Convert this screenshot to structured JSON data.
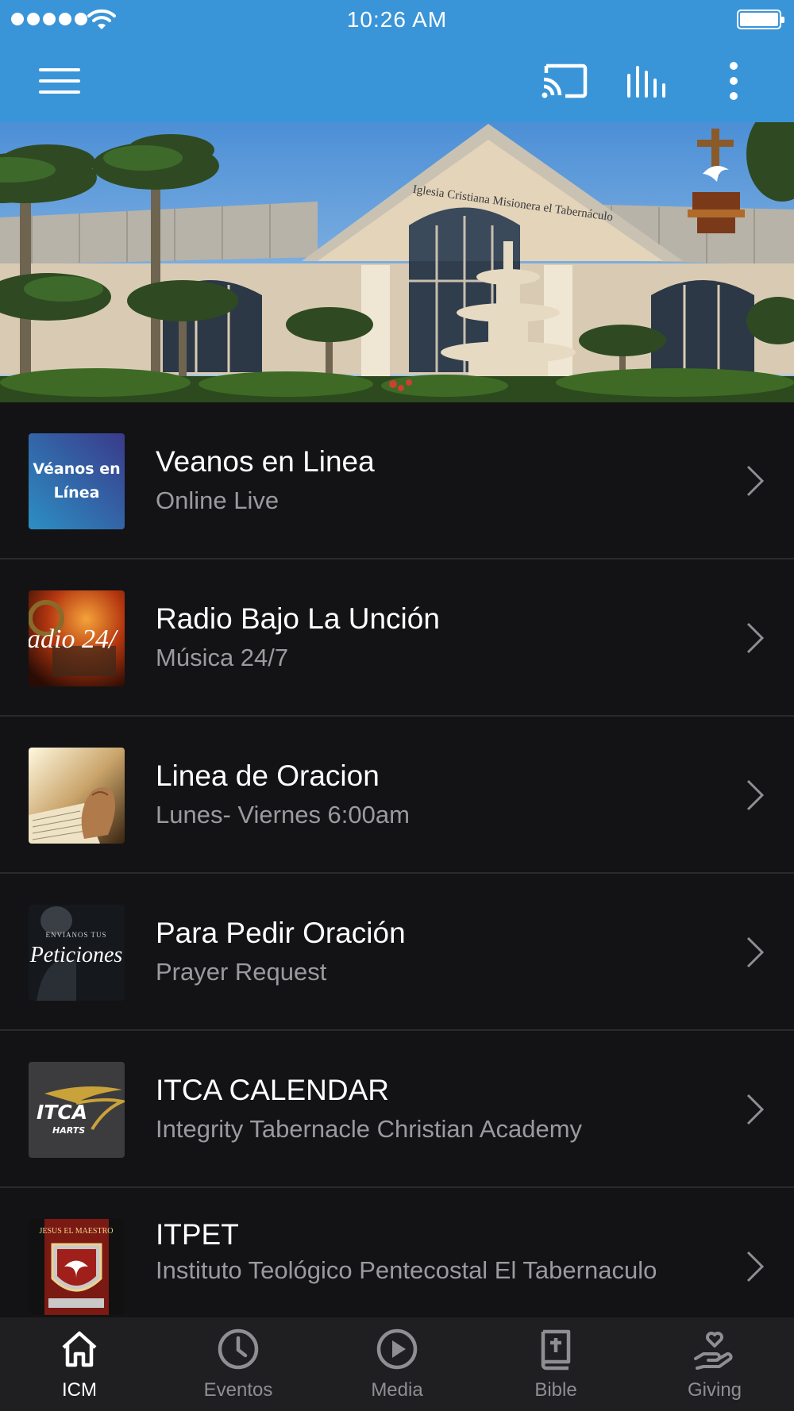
{
  "status_bar": {
    "time": "10:26 AM"
  },
  "toolbar": {
    "menu_icon": "hamburger-menu-icon",
    "cast_icon": "cast-icon",
    "audio_icon": "audio-equalizer-icon",
    "more_icon": "more-vertical-icon"
  },
  "hero": {
    "sign_text": "Iglesia Cristiana Misionera el Tabernáculo"
  },
  "list": {
    "items": [
      {
        "title": "Veanos en Linea",
        "subtitle": "Online Live",
        "thumb_text": "Véanos en Línea"
      },
      {
        "title": "Radio Bajo La Unción",
        "subtitle": "Música 24/7",
        "thumb_text": "adio 24/"
      },
      {
        "title": "Linea de Oracion",
        "subtitle": "Lunes- Viernes 6:00am"
      },
      {
        "title": "Para Pedir Oración",
        "subtitle": "Prayer Request",
        "thumb_text_small": "ENVIANOS TUS",
        "thumb_text": "Peticiones"
      },
      {
        "title": "ITCA CALENDAR",
        "subtitle": "Integrity Tabernacle Christian Academy",
        "thumb_text": "ITCA",
        "thumb_text_small": "HARTS"
      },
      {
        "title": "ITPET",
        "subtitle": "Instituto Teológico Pentecostal El Tabernaculo",
        "thumb_text_small": "JESUS EL MAESTRO"
      }
    ]
  },
  "tabbar": {
    "tabs": [
      {
        "label": "ICM",
        "icon": "home-icon",
        "active": true
      },
      {
        "label": "Eventos",
        "icon": "clock-icon",
        "active": false
      },
      {
        "label": "Media",
        "icon": "play-circle-icon",
        "active": false
      },
      {
        "label": "Bible",
        "icon": "bible-icon",
        "active": false
      },
      {
        "label": "Giving",
        "icon": "giving-hand-heart-icon",
        "active": false
      }
    ]
  },
  "colors": {
    "accent": "#3a95d8",
    "background": "#131315",
    "tabbar": "#1f1f22"
  }
}
